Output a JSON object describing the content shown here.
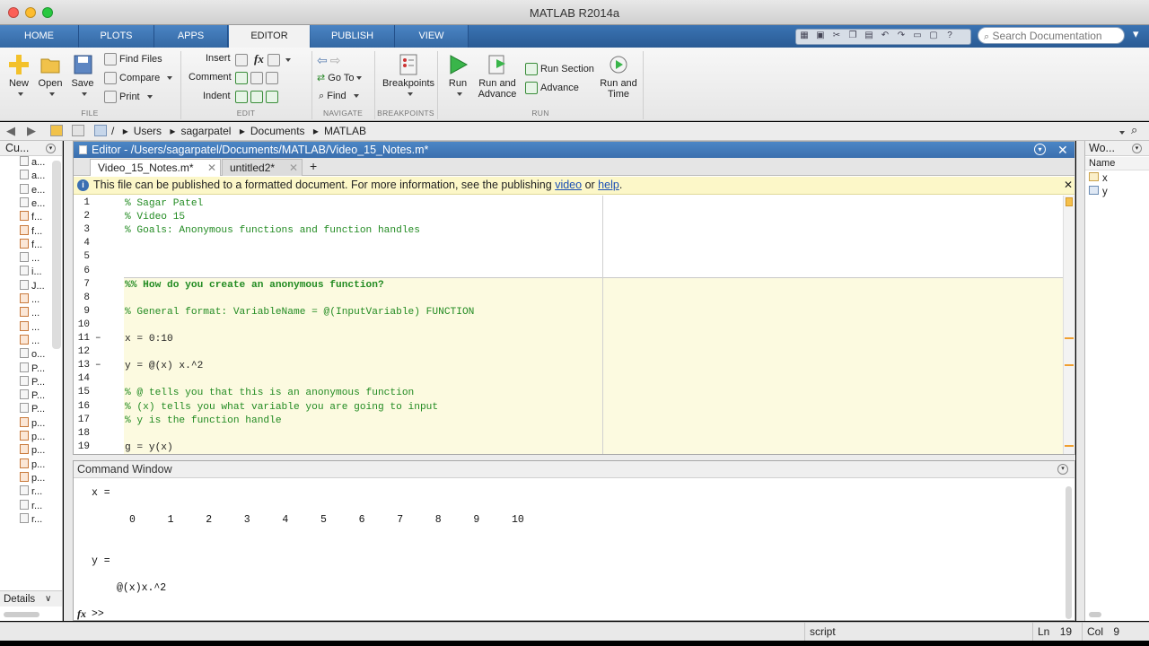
{
  "window": {
    "title": "MATLAB R2014a"
  },
  "ribbon_tabs": [
    "HOME",
    "PLOTS",
    "APPS",
    "EDITOR",
    "PUBLISH",
    "VIEW"
  ],
  "search": {
    "placeholder": "Search Documentation"
  },
  "ribbon": {
    "file": {
      "group": "FILE",
      "new": "New",
      "open": "Open",
      "save": "Save",
      "find_files": "Find Files",
      "compare": "Compare",
      "print": "Print"
    },
    "edit": {
      "group": "EDIT",
      "insert": "Insert",
      "comment": "Comment",
      "indent": "Indent",
      "fx": "fx"
    },
    "navigate": {
      "group": "NAVIGATE",
      "go_to": "Go To",
      "find": "Find"
    },
    "breakpoints": {
      "group": "BREAKPOINTS",
      "label": "Breakpoints"
    },
    "run": {
      "group": "RUN",
      "run": "Run",
      "run_and_advance": [
        "Run and",
        "Advance"
      ],
      "run_section": "Run Section",
      "advance": "Advance",
      "run_and_time": [
        "Run and",
        "Time"
      ]
    }
  },
  "path": [
    "/",
    "Users",
    "sagarpatel",
    "Documents",
    "MATLAB"
  ],
  "left_panel": {
    "title": "Cu...",
    "items": [
      "a...",
      "a...",
      "e...",
      "e...",
      "f...",
      "f...",
      "f...",
      "...",
      "i...",
      "J...",
      "...",
      "...",
      "...",
      "...",
      "o...",
      "P...",
      "P...",
      "P...",
      "P...",
      "p...",
      "p...",
      "p...",
      "p...",
      "p...",
      "r...",
      "r...",
      "r..."
    ],
    "details": "Details"
  },
  "editor": {
    "header": "Editor - /Users/sagarpatel/Documents/MATLAB/Video_15_Notes.m*",
    "tabs": [
      "Video_15_Notes.m*",
      "untitled2*"
    ],
    "add_tab": "+",
    "info": {
      "text": "This file can be published to a formatted document. For more information, see the publishing",
      "link1": "video",
      "or": "or",
      "link2": "help",
      "end": "."
    },
    "lines": [
      {
        "n": "1",
        "text": "% Sagar Patel",
        "type": "comment"
      },
      {
        "n": "2",
        "text": "% Video 15",
        "type": "comment"
      },
      {
        "n": "3",
        "text": "% Goals: Anonymous functions and function handles",
        "type": "comment"
      },
      {
        "n": "4",
        "text": "",
        "type": "code"
      },
      {
        "n": "5",
        "text": "",
        "type": "code"
      },
      {
        "n": "6",
        "text": "",
        "type": "code"
      },
      {
        "n": "7",
        "text": "%% How do you create an anonymous function?",
        "type": "cell"
      },
      {
        "n": "8",
        "text": "",
        "type": "code"
      },
      {
        "n": "9",
        "text": "% General format: VariableName = @(InputVariable) FUNCTION",
        "type": "comment"
      },
      {
        "n": "10",
        "text": "",
        "type": "code"
      },
      {
        "n": "11",
        "text": "x = 0:10",
        "type": "code",
        "dash": "–"
      },
      {
        "n": "12",
        "text": "",
        "type": "code"
      },
      {
        "n": "13",
        "text": "y = @(x) x.^2",
        "type": "code",
        "dash": "–"
      },
      {
        "n": "14",
        "text": "",
        "type": "code"
      },
      {
        "n": "15",
        "text": "% @ tells you that this is an anonymous function",
        "type": "comment"
      },
      {
        "n": "16",
        "text": "% (x) tells you what variable you are going to input",
        "type": "comment"
      },
      {
        "n": "17",
        "text": "% y is the function handle",
        "type": "comment"
      },
      {
        "n": "18",
        "text": "",
        "type": "code"
      },
      {
        "n": "19",
        "text": "g = y(x)",
        "type": "code"
      }
    ]
  },
  "command_window": {
    "title": "Command Window",
    "x_label": "x =",
    "x_values": [
      "0",
      "1",
      "2",
      "3",
      "4",
      "5",
      "6",
      "7",
      "8",
      "9",
      "10"
    ],
    "y_label": "y =",
    "y_value": "@(x)x.^2",
    "prompt_fx": "fx",
    "prompt": ">>"
  },
  "workspace": {
    "title": "Wo...",
    "column": "Name",
    "vars": [
      "x",
      "y"
    ]
  },
  "status": {
    "mode": "script",
    "ln_label": "Ln",
    "ln": "19",
    "col_label": "Col",
    "col": "9"
  },
  "colors": {
    "ribbon_blue": "#3a73b3",
    "comment_green": "#228b22",
    "cell_bg": "#fcfae0",
    "info_bg": "#fcf7c8"
  }
}
